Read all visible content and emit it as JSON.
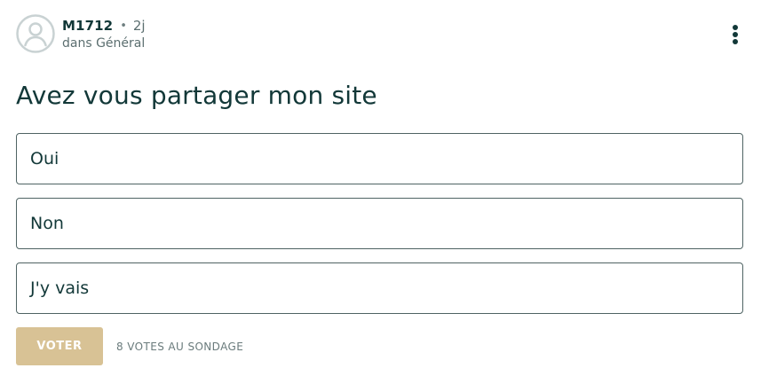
{
  "post": {
    "author": "M1712",
    "separator": "•",
    "time": "2j",
    "category": "dans Général",
    "icons": {
      "avatar": "user-avatar-icon",
      "more": "more-vertical-icon"
    }
  },
  "poll": {
    "question": "Avez vous partager mon site",
    "options": [
      {
        "label": "Oui"
      },
      {
        "label": "Non"
      },
      {
        "label": "J'y vais"
      }
    ],
    "vote_label": "VOTER",
    "votes_summary": "8 VOTES AU SONDAGE"
  },
  "colors": {
    "text_primary": "#123838",
    "text_secondary": "#5c6f70",
    "border": "#4f6363",
    "vote_button": "#d8c295",
    "avatar_outline": "#c9d2d3"
  }
}
